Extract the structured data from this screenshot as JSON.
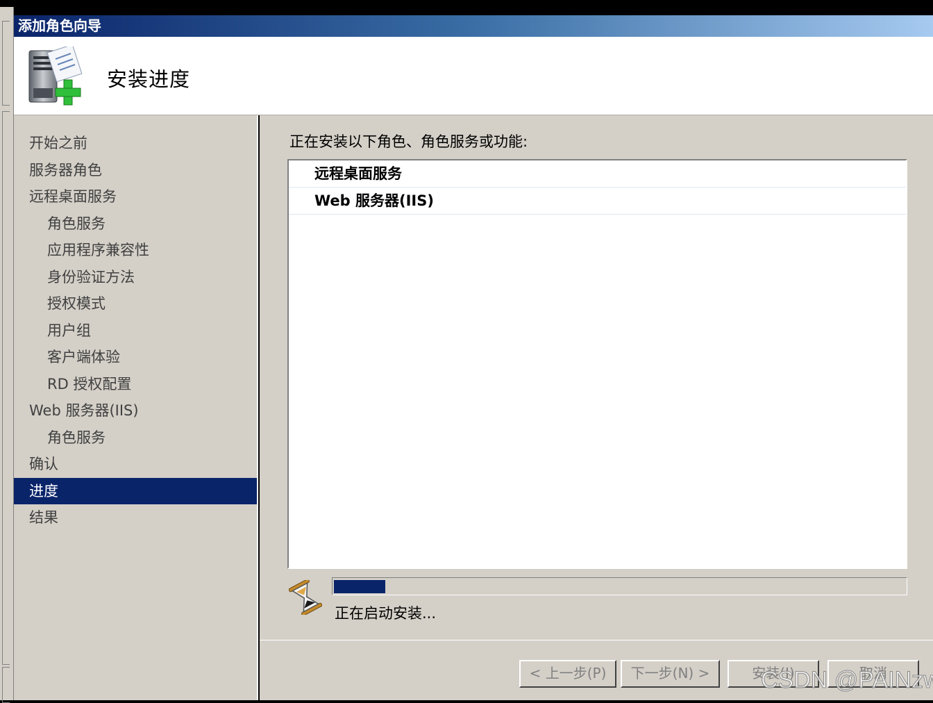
{
  "window": {
    "title": "添加角色向导"
  },
  "header": {
    "title": "安装进度",
    "icon": "server-add-icon"
  },
  "sidebar": {
    "items": [
      {
        "label": "开始之前",
        "level": 1
      },
      {
        "label": "服务器角色",
        "level": 1
      },
      {
        "label": "远程桌面服务",
        "level": 1
      },
      {
        "label": "角色服务",
        "level": 2
      },
      {
        "label": "应用程序兼容性",
        "level": 2
      },
      {
        "label": "身份验证方法",
        "level": 2
      },
      {
        "label": "授权模式",
        "level": 2
      },
      {
        "label": "用户组",
        "level": 2
      },
      {
        "label": "客户端体验",
        "level": 2
      },
      {
        "label": "RD 授权配置",
        "level": 2
      },
      {
        "label": "Web 服务器(IIS)",
        "level": 1
      },
      {
        "label": "角色服务",
        "level": 2
      },
      {
        "label": "确认",
        "level": 1
      },
      {
        "label": "进度",
        "level": 1,
        "active": true
      },
      {
        "label": "结果",
        "level": 1
      }
    ]
  },
  "main": {
    "intro": "正在安装以下角色、角色服务或功能:",
    "installing": [
      "远程桌面服务",
      "Web 服务器(IIS)"
    ],
    "progress": {
      "fraction": 0.09,
      "status": "正在启动安装..."
    }
  },
  "buttons": {
    "back": "< 上一步(P)",
    "next": "下一步(N) >",
    "install": "安装(I)",
    "cancel": "取消"
  },
  "watermark": "CSDN @PAINzw",
  "colors": {
    "active": "#0a246a",
    "panel": "#d4d0c8",
    "progress": "#0a246a"
  }
}
